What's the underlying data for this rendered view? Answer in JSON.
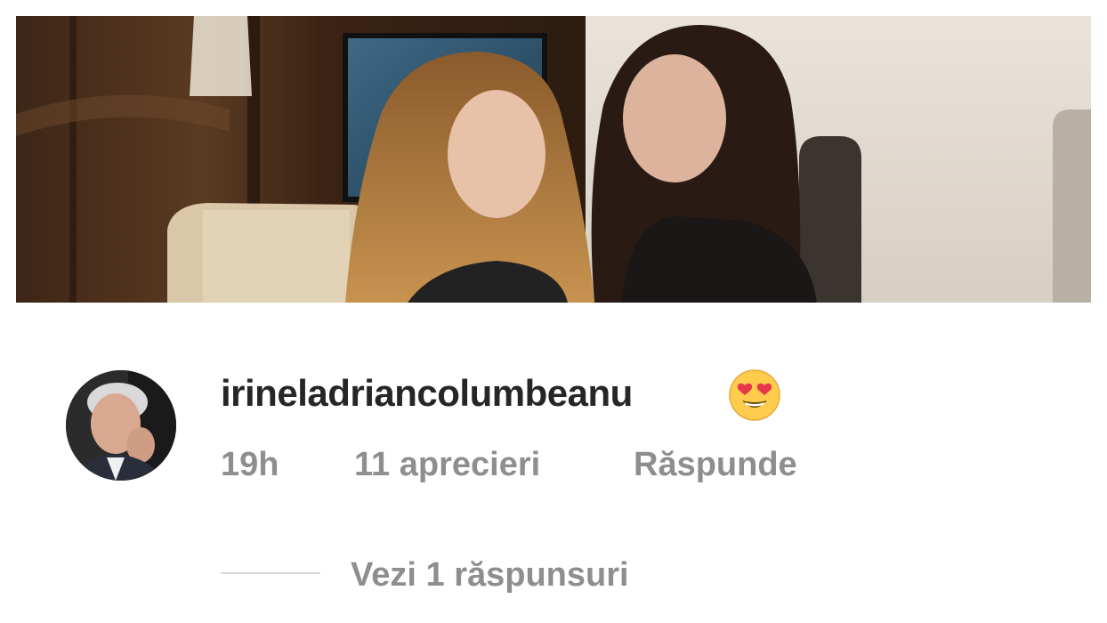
{
  "post": {
    "photo_description_icon": "photo-image"
  },
  "comment": {
    "username": "irineladriancolumbeanu",
    "emoji": "😍",
    "emoji_icon": "heart-eyes-emoji-icon",
    "time": "19h",
    "likes": "11 aprecieri",
    "reply_label": "Răspunde"
  },
  "replies": {
    "view_label": "Vezi 1 răspunsuri"
  },
  "colors": {
    "username": "#262626",
    "secondary_text": "#8e8e8e",
    "divider": "#d6d6d6",
    "background": "#ffffff"
  }
}
